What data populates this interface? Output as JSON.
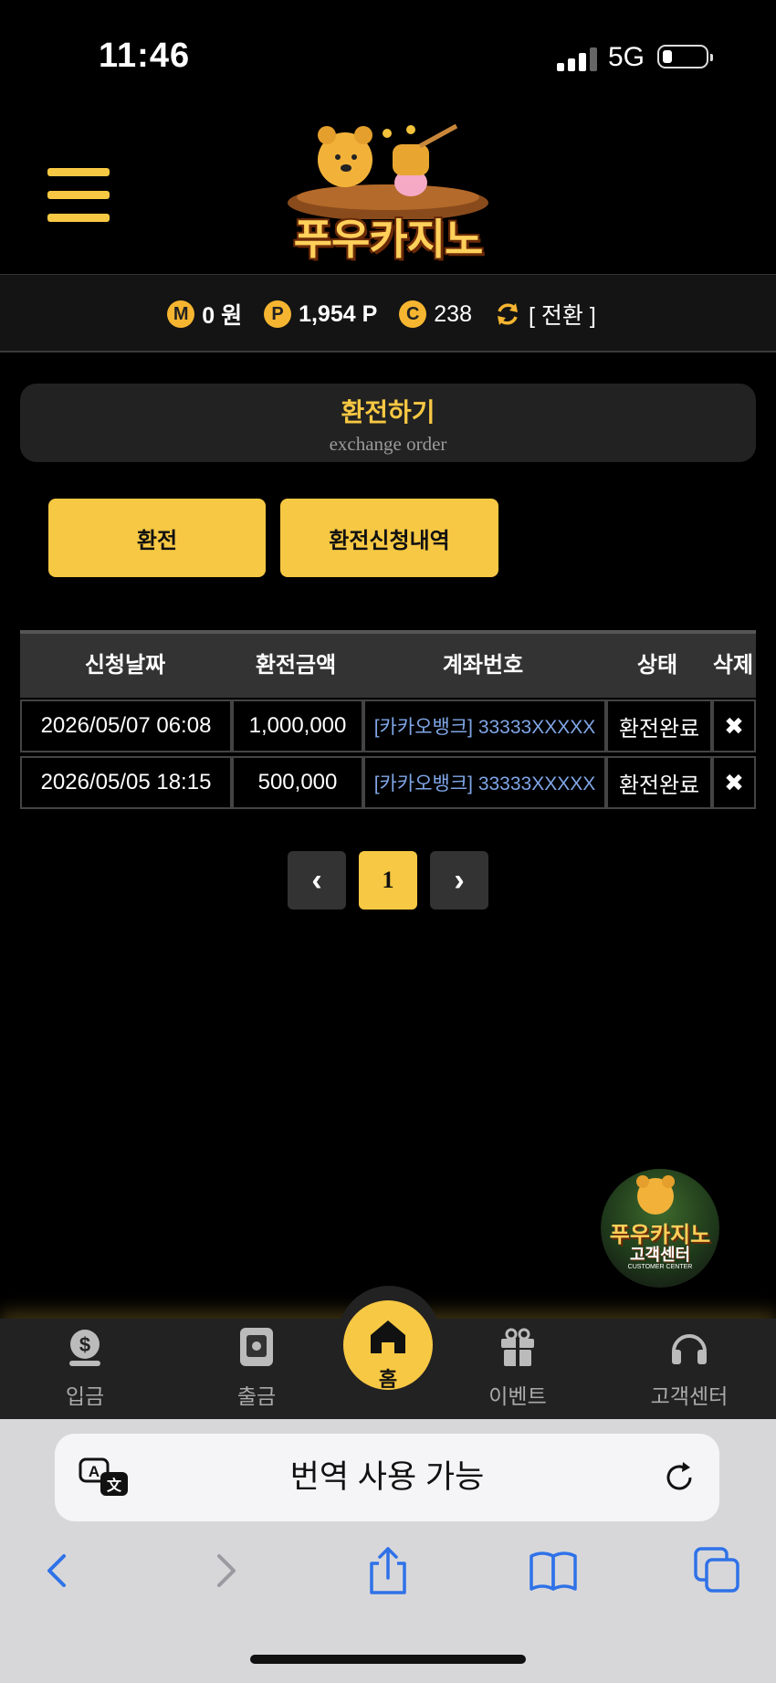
{
  "status": {
    "time": "11:46",
    "network": "5G"
  },
  "header": {
    "logo_text": "푸우카지노"
  },
  "balance": {
    "m_icon": "M",
    "money": "0 원",
    "p_icon": "P",
    "points": "1,954 P",
    "c_icon": "C",
    "coins": "238",
    "convert_label": "[ 전환 ]"
  },
  "page": {
    "title": "환전하기",
    "subtitle": "exchange order"
  },
  "tabs": [
    {
      "label": "환전"
    },
    {
      "label": "환전신청내역"
    }
  ],
  "table": {
    "headers": [
      "신청날짜",
      "환전금액",
      "계좌번호",
      "상태",
      "삭제"
    ],
    "rows": [
      {
        "date": "2026/05/07 06:08",
        "amount": "1,000,000",
        "account": "[카카오뱅크] 33333XXXXX",
        "status": "환전완료",
        "delete": "✖"
      },
      {
        "date": "2026/05/05 18:15",
        "amount": "500,000",
        "account": "[카카오뱅크] 33333XXXXX",
        "status": "환전완료",
        "delete": "✖"
      }
    ]
  },
  "pagination": {
    "prev": "‹",
    "current": "1",
    "next": "›"
  },
  "customer_center": {
    "line1": "푸우카지노",
    "line2": "고객센터",
    "line3": "CUSTOMER CENTER"
  },
  "bottom_nav": [
    {
      "label": "입금",
      "icon": "deposit-icon"
    },
    {
      "label": "출금",
      "icon": "withdraw-icon"
    },
    {
      "label": "홈",
      "icon": "home-icon"
    },
    {
      "label": "이벤트",
      "icon": "gift-icon"
    },
    {
      "label": "고객센터",
      "icon": "headset-icon"
    }
  ],
  "safari": {
    "translate_text": "번역 사용 가능"
  },
  "colors": {
    "accent": "#f7c843",
    "background": "#000000",
    "link": "#7fa6e6"
  }
}
